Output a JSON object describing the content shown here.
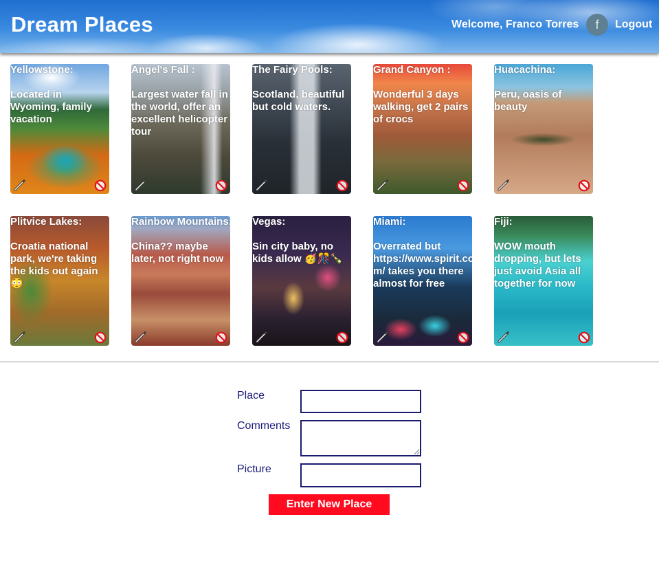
{
  "header": {
    "title": "Dream Places",
    "welcome": "Welcome, Franco Torres",
    "avatar_letter": "f",
    "logout": "Logout"
  },
  "places": [
    {
      "title": "Yellowstone:",
      "comment": "Located in Wyoming, family vacation"
    },
    {
      "title": "Angel's Fall :",
      "comment": "Largest water fall in the world, offer an excellent helicopter tour"
    },
    {
      "title": "The Fairy Pools:",
      "comment": "Scotland, beautiful but cold waters."
    },
    {
      "title": "Grand Canyon :",
      "comment": "Wonderful 3 days walking, get 2 pairs of crocs"
    },
    {
      "title": "Huacachina:",
      "comment": "Peru, oasis of beauty"
    },
    {
      "title": "Plitvice Lakes:",
      "comment": "Croatia national park, we're taking the kids out again 😳"
    },
    {
      "title": "Rainbow Mountains:",
      "comment": "China?? maybe later, not right now"
    },
    {
      "title": "Vegas:",
      "comment": "Sin city baby, no kids allow 🥳🎊🍾"
    },
    {
      "title": "Miami:",
      "comment": "Overrated but https://www.spirit.com/ takes you there almost for free"
    },
    {
      "title": "Fiji:",
      "comment": "WOW mouth dropping, but lets just avoid Asia all together for now"
    }
  ],
  "icons": {
    "edit": "pencil-icon",
    "delete": "prohibited-icon"
  },
  "form": {
    "place_label": "Place",
    "place_value": "",
    "comments_label": "Comments",
    "comments_value": "",
    "picture_label": "Picture",
    "picture_value": "",
    "submit_label": "Enter New Place"
  },
  "colors": {
    "submit_bg": "#ff0a1e",
    "label": "#1a1a7a",
    "header_blue": "#2a7ad8"
  }
}
